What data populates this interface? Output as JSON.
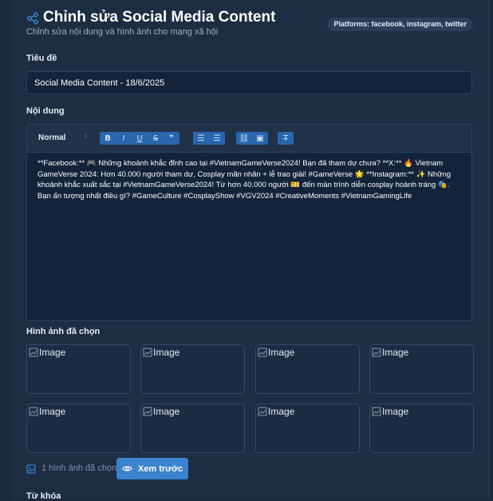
{
  "header": {
    "title": "Chỉnh sửa Social Media Content",
    "subtitle": "Chỉnh sửa nội dung và hình ảnh cho mạng xã hội",
    "platforms": "Platforms: facebook, instagram, twitter",
    "icon": "share-icon"
  },
  "title_field": {
    "label": "Tiêu đề",
    "value": "Social Media Content - 18/6/2025"
  },
  "content_field": {
    "label": "Nội dung",
    "toolbar": {
      "style_value": "Normal",
      "style_arrow": "⇕",
      "bold": "B",
      "italic": "I",
      "underline": "U",
      "strike": "S",
      "quote": "❞",
      "ordered_list": "☰",
      "bullet_list": "☰",
      "link": "⛓",
      "image": "▣",
      "clean": "T̶"
    },
    "text": "**Facebook:** 🎮 Những khoảnh khắc đỉnh cao tại #VietnamGameVerse2024! Bạn đã tham dự chưa? **X:** 🔥 Vietnam GameVerse 2024: Hơn 40.000 người tham dự, Cosplay mãn nhãn + lễ trao giải! #GameVerse 🌟 **Instagram:** ✨ Những khoảnh khắc xuất sắc tại #VietnamGameVerse2024! Từ hơn 40.000 người 🎫 đến màn trình diễn cosplay hoành tráng 🎭. Bạn ấn tượng nhất điều gì? #GameCulture #CosplayShow #VGV2024 #CreativeMoments #VietnamGamingLife"
  },
  "gallery": {
    "label": "Hình ảnh đã chọn",
    "images": [
      {
        "alt": "Image"
      },
      {
        "alt": "Image"
      },
      {
        "alt": "Image"
      },
      {
        "alt": "Image"
      },
      {
        "alt": "Image"
      },
      {
        "alt": "Image"
      },
      {
        "alt": "Image"
      },
      {
        "alt": "Image"
      }
    ],
    "count_text": "1 hình ảnh đã chọn",
    "preview_label": "Xem trước"
  },
  "keywords": {
    "label": "Từ khóa"
  },
  "colors": {
    "background": "#1b2a3f",
    "accent": "#3a83cf",
    "toolbar_button": "#2a66ad"
  }
}
